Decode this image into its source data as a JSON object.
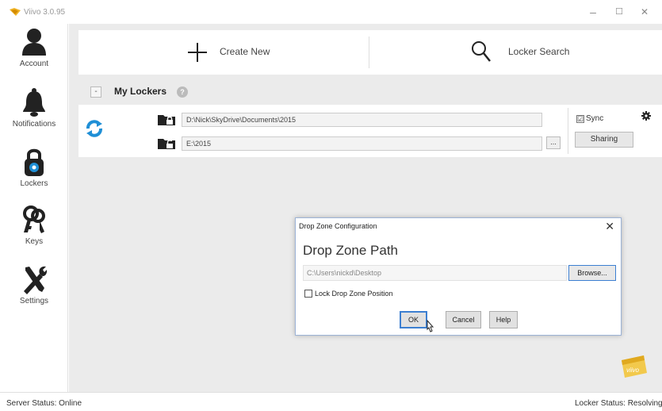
{
  "window": {
    "title": "Viivo 3.0.95",
    "minimize": "–",
    "maximize": "☐",
    "close": "✕"
  },
  "sidebar": {
    "items": [
      {
        "label": "Account",
        "icon": "person-icon"
      },
      {
        "label": "Notifications",
        "icon": "bell-icon"
      },
      {
        "label": "Lockers",
        "icon": "padlock-icon",
        "active": true
      },
      {
        "label": "Keys",
        "icon": "keys-icon"
      },
      {
        "label": "Settings",
        "icon": "tools-icon"
      }
    ]
  },
  "toolbar": {
    "create_label": "Create New",
    "search_label": "Locker Search"
  },
  "lockers": {
    "collapse": "-",
    "title": "My Lockers",
    "help": "?",
    "rows": [
      {
        "source_path": "D:\\Nick\\SkyDrive\\Documents\\2015",
        "target_path": "E:\\2015",
        "browse": "...",
        "sync_label": "Sync",
        "sync_checked": "☑",
        "sharing_label": "Sharing"
      }
    ]
  },
  "dialog": {
    "title": "Drop Zone Configuration",
    "close": "✕",
    "heading": "Drop Zone Path",
    "path_value": "C:\\Users\\nickd\\Desktop",
    "browse_label": "Browse...",
    "lock_label": "Lock Drop Zone Position",
    "ok_label": "OK",
    "cancel_label": "Cancel",
    "help_label": "Help"
  },
  "badge": "viivo",
  "status": {
    "server": "Server Status:  Online",
    "locker": "Locker Status:  Resolving"
  },
  "colors": {
    "accent_blue": "#1f8fd6",
    "content_bg": "#ebebeb",
    "badge_yellow": "#f2c94c"
  }
}
